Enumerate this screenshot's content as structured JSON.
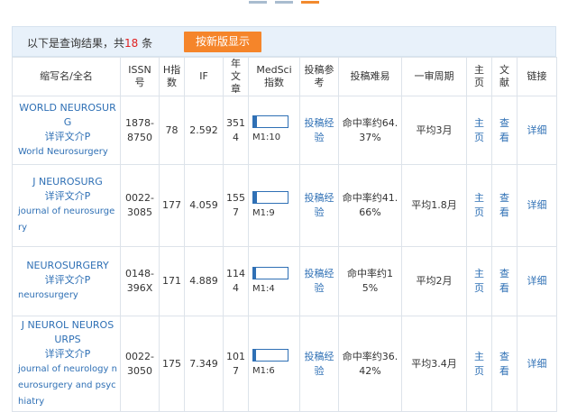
{
  "pager_tabs": [
    {
      "active": false
    },
    {
      "active": false
    },
    {
      "active": true
    }
  ],
  "header": {
    "prefix": "以下是查询结果，共",
    "count": "18",
    "suffix": "条",
    "new_button": "按新版显示"
  },
  "columns": {
    "name": "缩写名/全名",
    "issn": "ISSN号",
    "h": "H指数",
    "if": "IF",
    "articles": "年文章",
    "medsci": "MedSci指数",
    "ref": "投稿参考",
    "difficulty": "投稿难易",
    "review": "一审周期",
    "home": "主页",
    "lit": "文献",
    "link": "链接"
  },
  "rows": [
    {
      "abbr": "WORLD NEUROSURG",
      "detail": "详评文介P",
      "full": "World Neurosurgery",
      "issn": "1878-8750",
      "h": "78",
      "if": "2.592",
      "articles": "3514",
      "medsci_label": "M1:10",
      "medsci_level": 0.1,
      "ref": "投稿经验",
      "difficulty": "命中率约64.37%",
      "review": "平均3月",
      "home": "主页",
      "lit": "查看",
      "link": "详细"
    },
    {
      "abbr": "J NEUROSURG",
      "detail": "详评文介P",
      "full": "journal of neurosurgery",
      "issn": "0022-3085",
      "h": "177",
      "if": "4.059",
      "articles": "1557",
      "medsci_label": "M1:9",
      "medsci_level": 0.1,
      "ref": "投稿经验",
      "difficulty": "命中率约41.66%",
      "review": "平均1.8月",
      "home": "主页",
      "lit": "查看",
      "link": "详细"
    },
    {
      "abbr": "NEUROSURGERY",
      "detail": "详评文介P",
      "full": "neurosurgery",
      "issn": "0148-396X",
      "h": "171",
      "if": "4.889",
      "articles": "1144",
      "medsci_label": "M1:4",
      "medsci_level": 0.05,
      "ref": "投稿经验",
      "difficulty": "命中率约15%",
      "review": "平均2月",
      "home": "主页",
      "lit": "查看",
      "link": "详细"
    },
    {
      "abbr": "J NEUROL NEUROSURPS",
      "detail": "详评文介P",
      "full": "journal of neurology neurosurgery and psychiatry",
      "issn": "0022-3050",
      "h": "175",
      "if": "7.349",
      "articles": "1017",
      "medsci_label": "M1:6",
      "medsci_level": 0.05,
      "ref": "投稿经验",
      "difficulty": "命中率约36.42%",
      "review": "平均3.4月",
      "home": "主页",
      "lit": "查看",
      "link": "详细"
    }
  ]
}
